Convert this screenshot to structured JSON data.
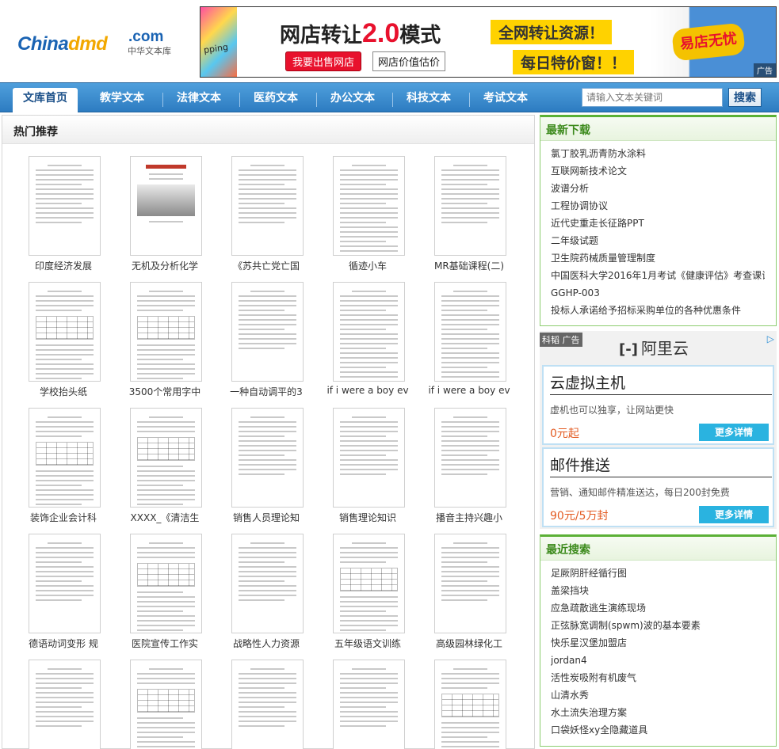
{
  "logo": {
    "main_a": "China",
    "main_b": "dmd",
    "com": ".com",
    "subtitle": "中华文本库"
  },
  "banner": {
    "title_a": "网店转让",
    "title_big": "2.0",
    "title_b": "模式",
    "btn_sell": "我要出售网店",
    "btn_value": "网店价值估价",
    "promo_1": "全网转让资源！",
    "promo_2": "每日特价窗！！",
    "left_text": "pping",
    "brand": "易店无忧",
    "ad_label": "广告"
  },
  "nav": {
    "items": [
      {
        "label": "文库首页"
      },
      {
        "label": "教学文本"
      },
      {
        "label": "法律文本"
      },
      {
        "label": "医药文本"
      },
      {
        "label": "办公文本"
      },
      {
        "label": "科技文本"
      },
      {
        "label": "考试文本"
      }
    ],
    "search_placeholder": "请输入文本关键词",
    "search_button": "搜索"
  },
  "main": {
    "title": "热门推荐",
    "docs": [
      {
        "title": "印度经济发展"
      },
      {
        "title": "无机及分析化学"
      },
      {
        "title": "《苏共亡党亡国"
      },
      {
        "title": "循迹小车"
      },
      {
        "title": "MR基础课程(二)"
      },
      {
        "title": "学校抬头纸"
      },
      {
        "title": "3500个常用字中"
      },
      {
        "title": "一种自动调平的3"
      },
      {
        "title": "if i were a boy ev"
      },
      {
        "title": "if i were a boy ev"
      },
      {
        "title": "装饰企业会计科"
      },
      {
        "title": "XXXX_《清洁生"
      },
      {
        "title": "销售人员理论知"
      },
      {
        "title": "销售理论知识"
      },
      {
        "title": "播音主持兴趣小"
      },
      {
        "title": "德语动词变形 规"
      },
      {
        "title": "医院宣传工作实"
      },
      {
        "title": "战略性人力资源"
      },
      {
        "title": "五年级语文训练"
      },
      {
        "title": "高级园林绿化工"
      },
      {
        "title": ""
      },
      {
        "title": ""
      },
      {
        "title": ""
      },
      {
        "title": ""
      },
      {
        "title": ""
      }
    ]
  },
  "latest": {
    "title": "最新下载",
    "items": [
      "氯丁胶乳沥青防水涂料",
      "互联网新技术论文",
      "波谱分析",
      "工程协调协议",
      "近代史重走长征路PPT",
      "二年级试题",
      "卫生院药械质量管理制度",
      "中国医科大学2016年1月考试《健康评估》考查课试题",
      "GGHP-003",
      "投标人承诺给予招标采购单位的各种优惠条件"
    ]
  },
  "ad": {
    "tag": "科韬 广告",
    "brand": "阿里云",
    "cards": [
      {
        "heading": "云虚拟主机",
        "desc": "虚机也可以独享，让网站更快",
        "price": "0元起",
        "button": "更多详情"
      },
      {
        "heading": "邮件推送",
        "desc": "营销、通知邮件精准送达，每日200封免费",
        "price": "90元/5万封",
        "button": "更多详情"
      }
    ]
  },
  "recent": {
    "title": "最近搜索",
    "items": [
      "足厥阴肝经循行图",
      "盖梁挡块",
      "应急疏散逃生演练现场",
      "正弦脉宽调制(spwm)波的基本要素",
      "快乐星汉堡加盟店",
      "jordan4",
      "活性炭吸附有机废气",
      "山清水秀",
      "水土流失治理方案",
      "口袋妖怪xy全隐藏道具"
    ]
  }
}
